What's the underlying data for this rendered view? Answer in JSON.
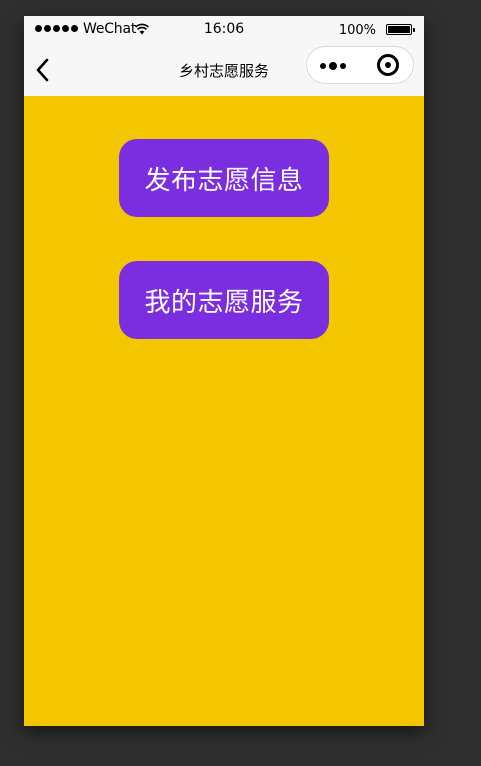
{
  "status_bar": {
    "carrier": "WeChat",
    "time": "16:06",
    "battery_percent": "100%"
  },
  "nav_bar": {
    "title": "乡村志愿服务",
    "back_icon": "chevron-left-icon",
    "more_icon": "more-dots-icon",
    "close_icon": "target-circle-icon"
  },
  "main": {
    "background_color": "#f3c600",
    "button_color": "#7b2ee0",
    "buttons": [
      {
        "label": "发布志愿信息"
      },
      {
        "label": "我的志愿服务"
      }
    ]
  }
}
